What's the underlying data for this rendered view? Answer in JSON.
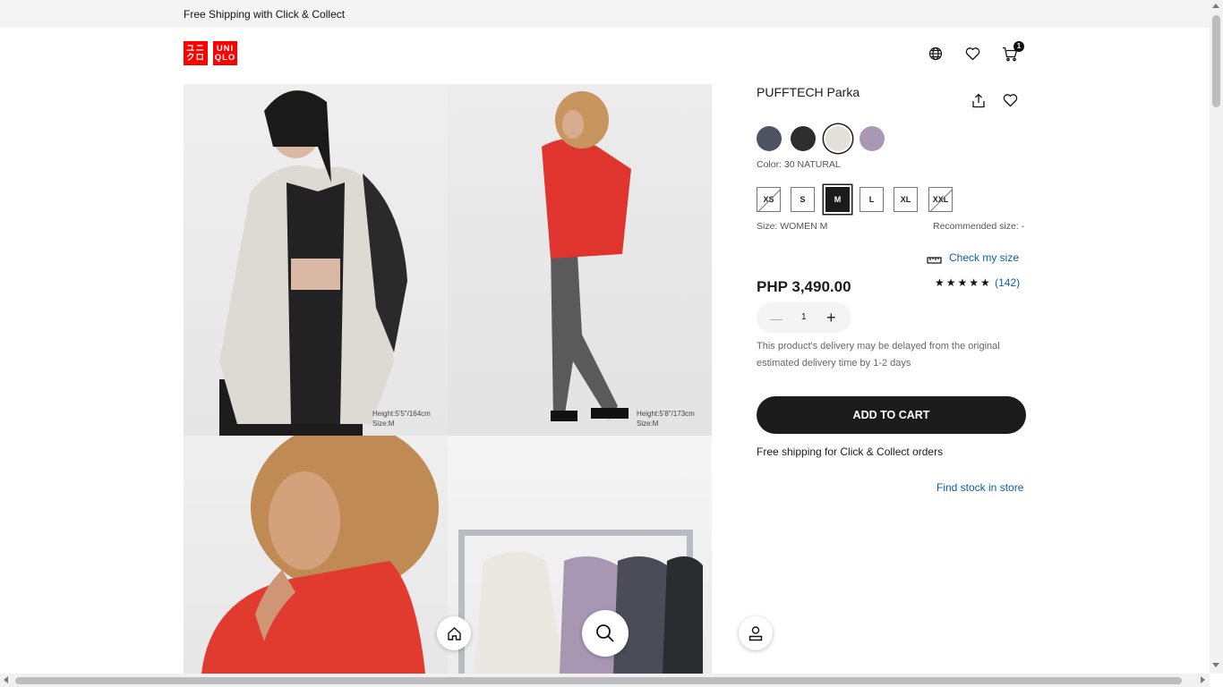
{
  "banner": {
    "text": "Free Shipping with Click & Collect"
  },
  "logo": {
    "top": "ユニ",
    "right": "UNI",
    "bottom_left": "クロ",
    "bottom_right": "QLO"
  },
  "header": {
    "cart_count": "1"
  },
  "gallery": {
    "captions": [
      {
        "height": "Height:5'5\"/164cm",
        "size": "Size:M"
      },
      {
        "height": "Height:5'8\"/173cm",
        "size": "Size:M"
      }
    ]
  },
  "product": {
    "title": "PUFFTECH Parka",
    "colors": [
      {
        "hex": "#4f5260"
      },
      {
        "hex": "#2d2d2d"
      },
      {
        "hex": "#e3e0da"
      },
      {
        "hex": "#a898b3"
      }
    ],
    "color_label": "Color: 30 NATURAL",
    "sizes": [
      {
        "label": "XS",
        "state": "unavailable"
      },
      {
        "label": "S",
        "state": "available"
      },
      {
        "label": "M",
        "state": "selected"
      },
      {
        "label": "L",
        "state": "available"
      },
      {
        "label": "XL",
        "state": "available"
      },
      {
        "label": "XXL",
        "state": "unavailable"
      }
    ],
    "size_label": "Size: WOMEN M",
    "recommended_size": "Recommended size: -",
    "check_size": "Check my size",
    "price": "PHP 3,490.00",
    "stars": "★★★★★",
    "rating_count": "(142)",
    "rating_value": 5,
    "quantity": "1",
    "delivery_note": "This product's delivery may be delayed from the original estimated delivery time by 1-2 days",
    "add_to_cart": "ADD TO CART",
    "shipping_note": "Free shipping for Click & Collect orders",
    "find_stock": "Find stock in store"
  }
}
